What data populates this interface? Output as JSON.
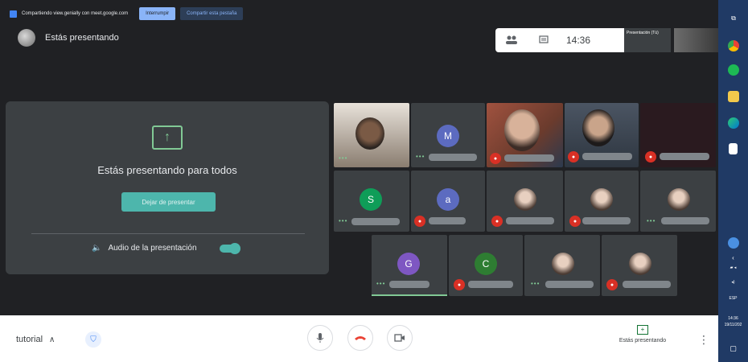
{
  "share_banner": {
    "text": "Compartiendo view.genially con meet.google.com",
    "stop_label": "Interrumpir",
    "share_window_label": "Compartir esta pestaña"
  },
  "header": {
    "presenting_label": "Estás presentando"
  },
  "top_bar": {
    "time": "14:36",
    "mini_tile_label": "Presentación (Tú)"
  },
  "presentation_panel": {
    "message": "Estás presentando para todos",
    "stop_button": "Dejar de presentar",
    "audio_label": "Audio de la presentación"
  },
  "participants": [
    {
      "initial": "M",
      "color": "#5c6bc0"
    },
    {
      "initial": "S",
      "color": "#0f9d58"
    },
    {
      "initial": "a",
      "color": "#5c6bc0"
    },
    {
      "initial": "G",
      "color": "#7e57c2"
    },
    {
      "initial": "C",
      "color": "#2e7d32"
    }
  ],
  "bottom_bar": {
    "meeting_name": "tutorial",
    "present_label": "Estás presentando"
  },
  "taskbar": {
    "lang": "ESP",
    "time": "14:36",
    "date": "19/11/202"
  }
}
